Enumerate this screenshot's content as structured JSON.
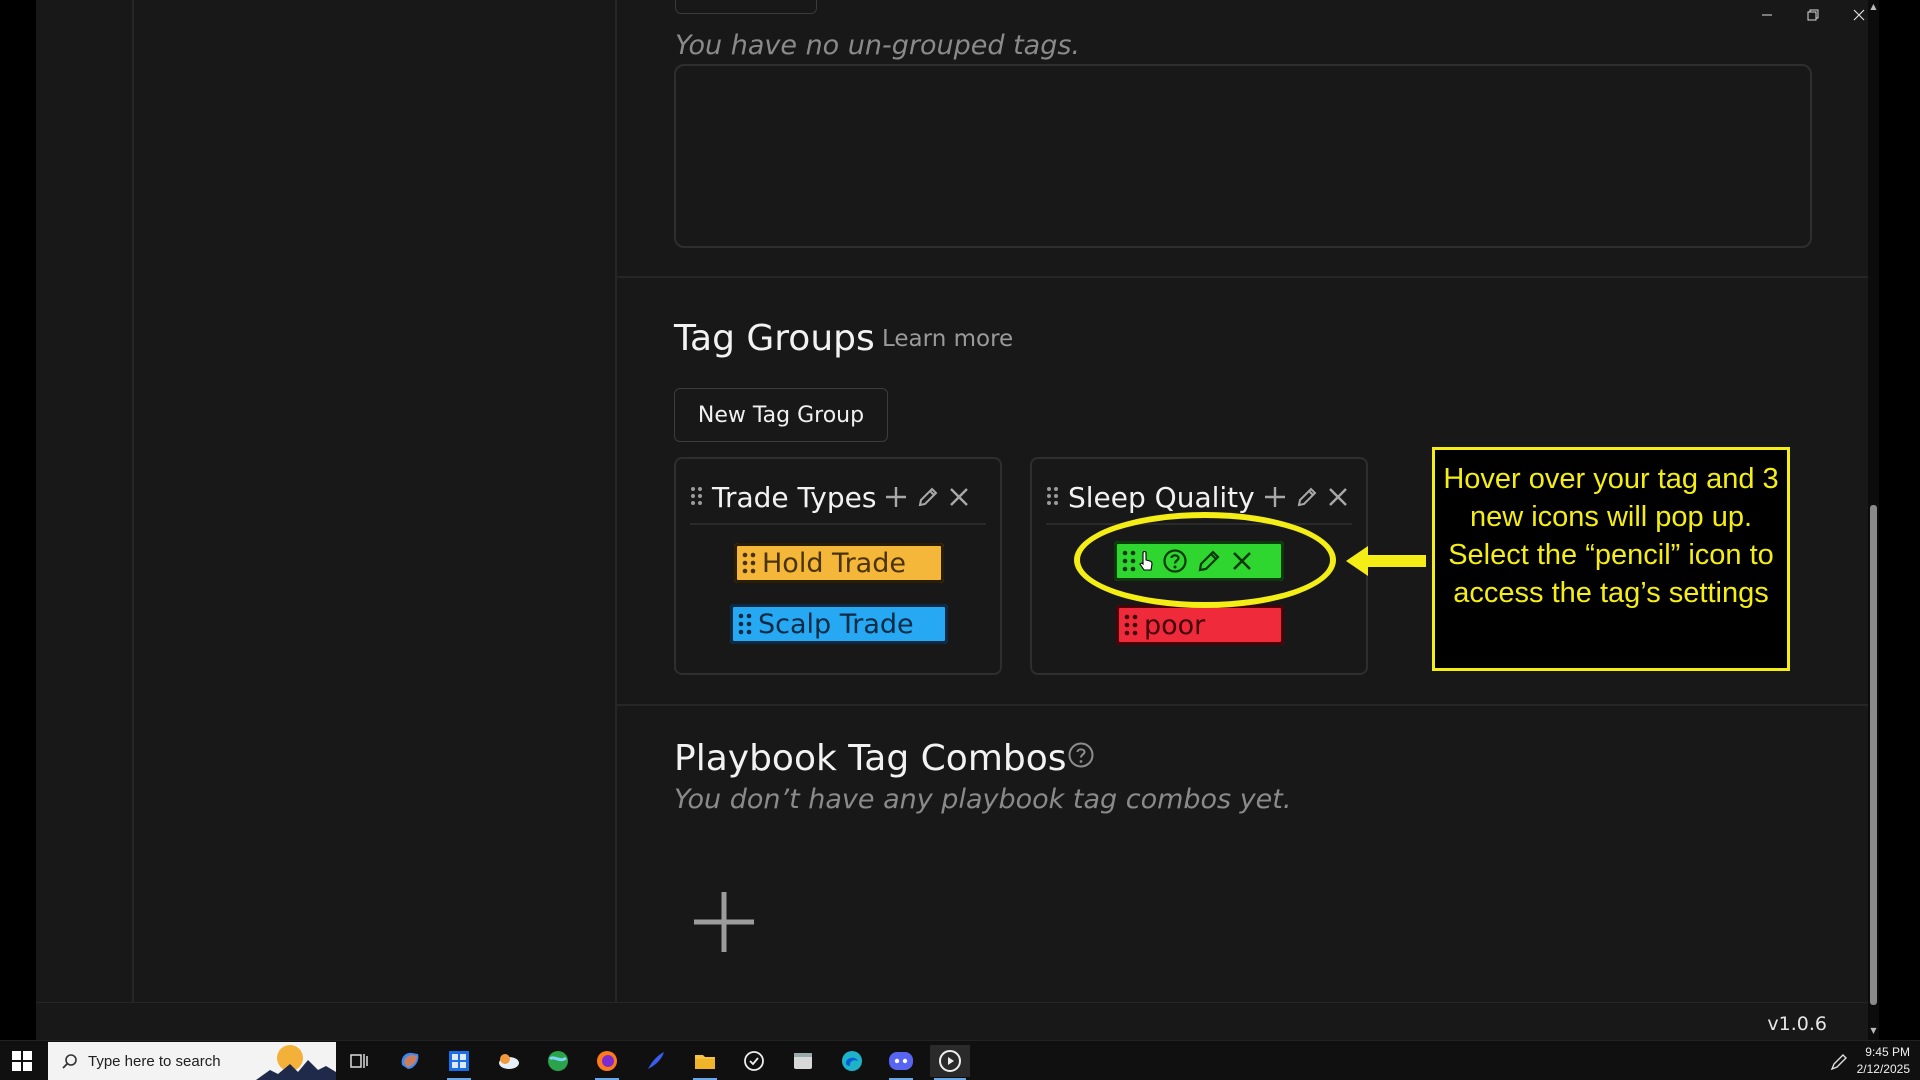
{
  "window": {
    "controls": [
      "minimize-icon",
      "restore-icon",
      "close-icon"
    ]
  },
  "ungrouped": {
    "empty_text": "You have no un-grouped tags."
  },
  "tag_groups": {
    "title": "Tag Groups",
    "learn_more": "Learn more",
    "new_group_label": "New Tag Group",
    "groups": [
      {
        "name": "Trade Types",
        "tags": [
          {
            "label": "Hold Trade",
            "color": "#f5b73a"
          },
          {
            "label": "Scalp Trade",
            "color": "#27a8f2"
          }
        ]
      },
      {
        "name": "Sleep Quality",
        "tags": [
          {
            "label": "",
            "color": "#2fd62f",
            "hover_icons": [
              "drag-handle-icon",
              "help-icon",
              "pencil-icon",
              "close-icon"
            ]
          },
          {
            "label": "poor",
            "color": "#ee2a3b"
          }
        ]
      }
    ]
  },
  "annotation": {
    "callout_text": "Hover over your tag and 3 new icons will pop up. Select the “pencil” icon to access the tag’s settings",
    "color": "#f4ee16"
  },
  "playbook": {
    "title": "Playbook Tag Combos",
    "empty_text": "You don’t have any playbook tag combos yet."
  },
  "footer": {
    "version": "v1.0.6"
  },
  "taskbar": {
    "search_placeholder": "Type here to search",
    "time": "9:45 PM",
    "date": "2/12/2025"
  }
}
